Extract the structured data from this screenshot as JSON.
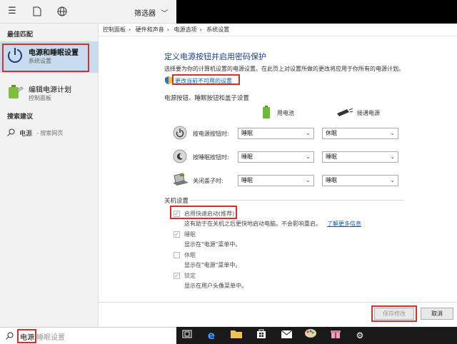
{
  "start": {
    "filter_label": "筛选器",
    "section_best": "最佳匹配",
    "best_title": "电源和睡眠设置",
    "best_sub": "系统设置",
    "second_title": "编辑电源计划",
    "second_sub": "控制面板",
    "section_suggest": "搜索建议",
    "suggest_text": "电源",
    "suggest_sub": "- 搜索网页"
  },
  "breadcrumb": [
    "控制面板",
    "硬件和声音",
    "电源选项",
    "系统设置"
  ],
  "panel": {
    "title": "定义电源按钮并启用密码保护",
    "desc": "选择要为你的计算机设置的电源设置。在此页上对设置所做的更改将应用于你所有的电源计划。",
    "change_link": "更改当前不可用的设置",
    "section1": "电源按钮、睡眠按钮和盖子设置",
    "col_battery": "用电池",
    "col_plugged": "接通电源",
    "rows": [
      {
        "label": "按电源按钮时:",
        "battery": "睡眠",
        "plugged": "休眠"
      },
      {
        "label": "按睡眠按钮时:",
        "battery": "睡眠",
        "plugged": "睡眠"
      },
      {
        "label": "关闭盖子时:",
        "battery": "睡眠",
        "plugged": "睡眠"
      }
    ],
    "section2": "关机设置",
    "fast_startup": "启用快速启动(推荐)",
    "fast_desc": "这有助于在关机之后更快地启动电脑。不会影响重启。",
    "learn_more": "了解更多信息",
    "sleep_label": "睡眠",
    "sleep_desc": "显示在\"电源\"菜单中。",
    "hibernate_label": "休眠",
    "hibernate_desc": "显示在\"电源\"菜单中。",
    "lock_label": "锁定",
    "lock_desc": "显示在用户头像菜单中。",
    "save_button": "保存修改",
    "cancel_button": "取消"
  },
  "taskbar": {
    "search_typed": "电源",
    "search_hint": "睡眠设置"
  }
}
